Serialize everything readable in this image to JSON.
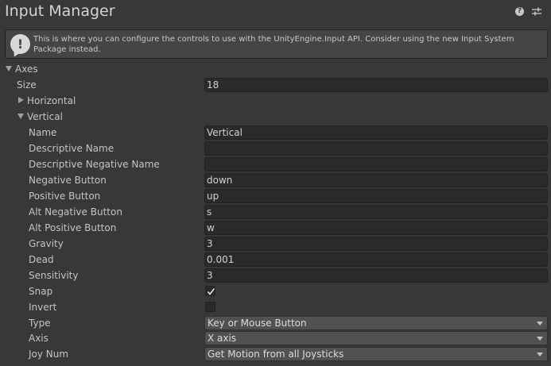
{
  "header": {
    "title": "Input Manager",
    "icons": [
      "help-icon",
      "settings-sliders-icon"
    ]
  },
  "help_box": {
    "text": "This is where you can configure the controls to use with the UnityEngine.Input API. Consider using the new Input System Package instead.",
    "icon": "info-speech-icon"
  },
  "axes": {
    "label": "Axes",
    "expanded": true,
    "size_label": "Size",
    "size_value": "18",
    "horizontal": {
      "label": "Horizontal",
      "expanded": false
    },
    "vertical": {
      "label": "Vertical",
      "expanded": true,
      "fields": {
        "name": {
          "label": "Name",
          "value": "Vertical"
        },
        "descriptive_name": {
          "label": "Descriptive Name",
          "value": ""
        },
        "descriptive_negative_name": {
          "label": "Descriptive Negative Name",
          "value": ""
        },
        "negative_button": {
          "label": "Negative Button",
          "value": "down"
        },
        "positive_button": {
          "label": "Positive Button",
          "value": "up"
        },
        "alt_negative_button": {
          "label": "Alt Negative Button",
          "value": "s"
        },
        "alt_positive_button": {
          "label": "Alt Positive Button",
          "value": "w"
        },
        "gravity": {
          "label": "Gravity",
          "value": "3"
        },
        "dead": {
          "label": "Dead",
          "value": "0.001"
        },
        "sensitivity": {
          "label": "Sensitivity",
          "value": "3"
        },
        "snap": {
          "label": "Snap",
          "checked": true
        },
        "invert": {
          "label": "Invert",
          "checked": false
        },
        "type": {
          "label": "Type",
          "value": "Key or Mouse Button"
        },
        "axis": {
          "label": "Axis",
          "value": "X axis"
        },
        "joy_num": {
          "label": "Joy Num",
          "value": "Get Motion from all Joysticks"
        }
      }
    }
  }
}
